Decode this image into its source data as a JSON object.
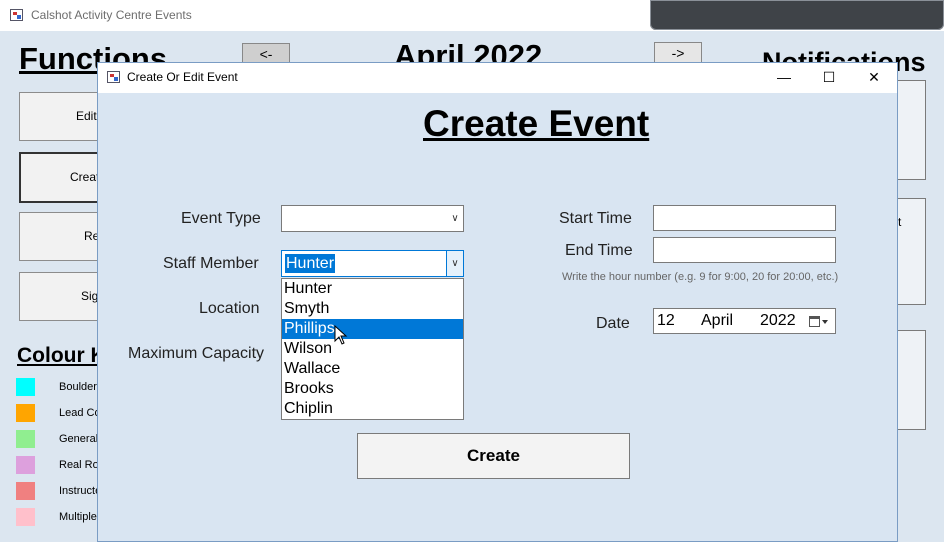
{
  "main_window": {
    "title": "Calshot Activity Centre Events",
    "functions_heading": "Functions",
    "month_heading": "April 2022",
    "notifications_heading": "Notifications",
    "prev_month_label": "<-",
    "next_month_label": "->",
    "function_buttons": [
      "Edit",
      "Create",
      "Re",
      "Sig"
    ],
    "colour_heading": "Colour K",
    "legend": [
      {
        "label": "Boulderi",
        "color": "#00ffff"
      },
      {
        "label": "Lead Co",
        "color": "#ffa500"
      },
      {
        "label": "General",
        "color": "#90ee90"
      },
      {
        "label": "Real Ro",
        "color": "#dda0dd"
      },
      {
        "label": "Instructe",
        "color": "#f08080"
      },
      {
        "label": "Multiple",
        "color": "#ffc0cb"
      }
    ],
    "notification_fragment": "t"
  },
  "dialog": {
    "title": "Create Or Edit Event",
    "minimize": "—",
    "maximize": "☐",
    "close": "✕",
    "heading": "Create Event",
    "labels": {
      "event_type": "Event Type",
      "staff_member": "Staff Member",
      "location": "Location",
      "maximum_capacity": "Maximum Capacity",
      "start_time": "Start Time",
      "end_time": "End Time",
      "date": "Date"
    },
    "event_type_value": "",
    "staff_member_value": "Hunter",
    "start_time_value": "",
    "end_time_value": "",
    "hint": "Write the hour number (e.g. 9 for 9:00, 20 for 20:00, etc.)",
    "date": {
      "day": "12",
      "month": "April",
      "year": "2022"
    },
    "staff_options": [
      "Hunter",
      "Smyth",
      "Phillips",
      "Wilson",
      "Wallace",
      "Brooks",
      "Chiplin"
    ],
    "highlighted_option": "Phillips",
    "create_button": "Create"
  }
}
